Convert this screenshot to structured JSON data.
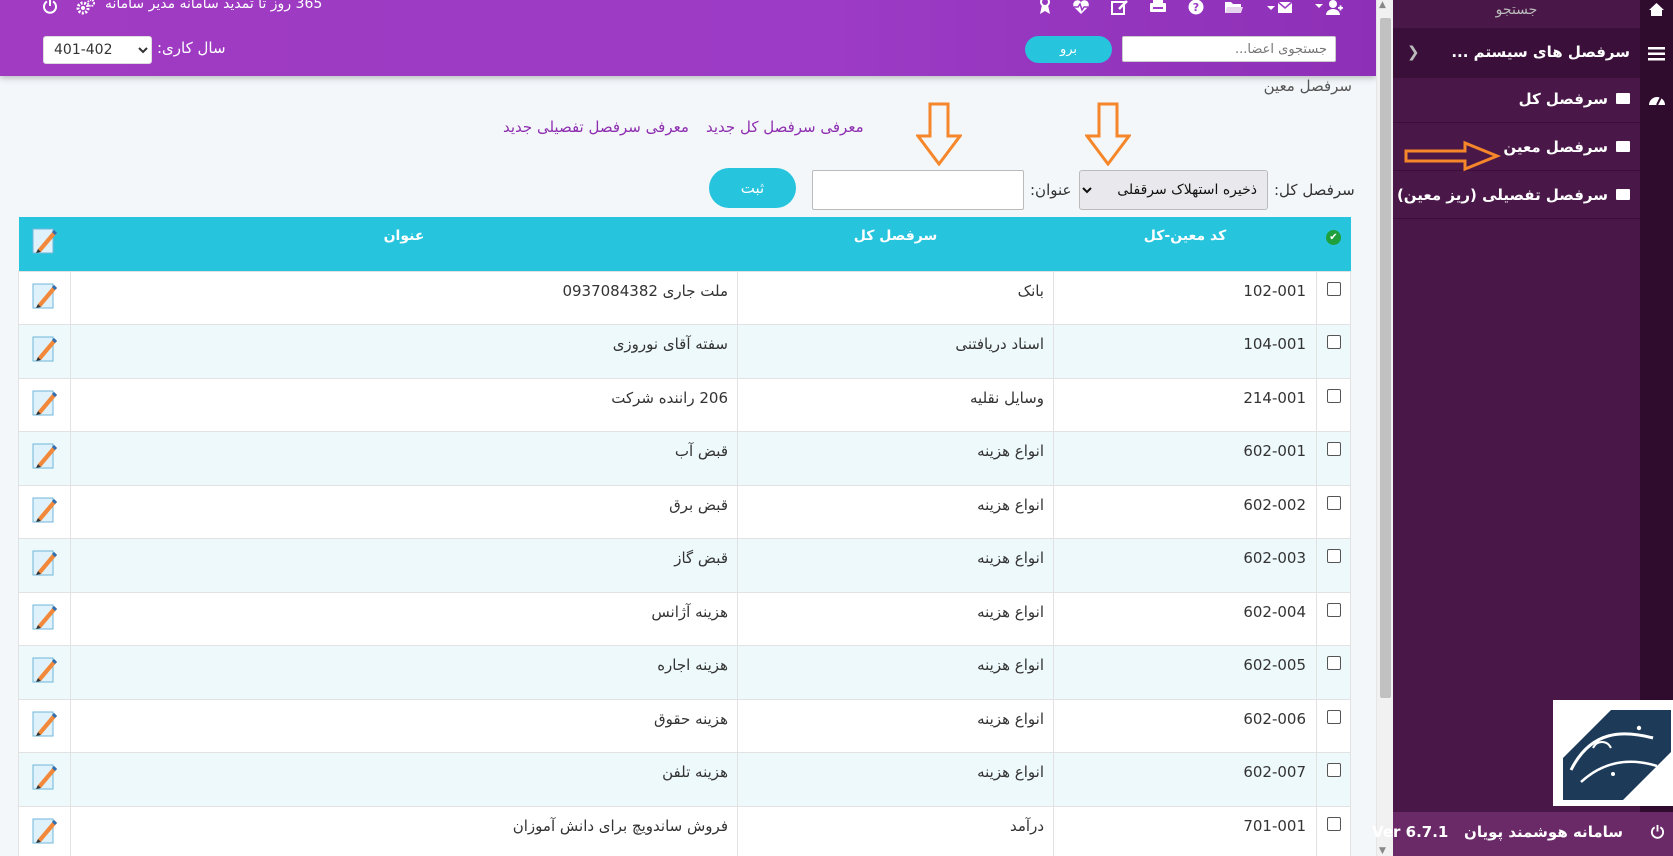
{
  "topbar": {
    "subscription_text": "365 روز تا تمدید سامانه مدیر سامانه",
    "fiscal_year_label": "سال کاری:",
    "fiscal_year_value": "401-402",
    "search_placeholder": "جستجوی اعضا...",
    "search_go_label": "برو",
    "icons": [
      "user-plus-icon",
      "envelope-icon",
      "folder-open-icon",
      "help-icon",
      "printer-icon",
      "edit-note-icon",
      "heartbeat-icon",
      "ribbon-icon"
    ]
  },
  "breadcrumb": "سرفصل معین",
  "links": {
    "new_general": "معرفی سرفصل کل جدید",
    "new_detail": "معرفی سرفصل تفصیلی جدید"
  },
  "form": {
    "general_label": "سرفصل کل:",
    "general_selected": "ذخیره استهلاک سرقفلی",
    "title_label": "عنوان:",
    "title_value": "",
    "save_label": "ثبت"
  },
  "table": {
    "headers": {
      "code": "کد معین-کل",
      "general": "سرفصل کل",
      "title": "عنوان"
    },
    "rows": [
      {
        "code": "102-001",
        "general": "بانک",
        "title": "ملت جاری 0937084382"
      },
      {
        "code": "104-001",
        "general": "اسناد دریافتنی",
        "title": "سفته آقای نوروزی"
      },
      {
        "code": "214-001",
        "general": "وسایل نقلیه",
        "title": "206 راننده شرکت"
      },
      {
        "code": "602-001",
        "general": "انواع هزینه",
        "title": "قبض آب"
      },
      {
        "code": "602-002",
        "general": "انواع هزینه",
        "title": "قبض برق"
      },
      {
        "code": "602-003",
        "general": "انواع هزینه",
        "title": "قبض گاز"
      },
      {
        "code": "602-004",
        "general": "انواع هزینه",
        "title": "هزینه آژانس"
      },
      {
        "code": "602-005",
        "general": "انواع هزینه",
        "title": "هزینه اجاره"
      },
      {
        "code": "602-006",
        "general": "انواع هزینه",
        "title": "هزینه حقوق"
      },
      {
        "code": "602-007",
        "general": "انواع هزینه",
        "title": "هزینه تلفن"
      },
      {
        "code": "701-001",
        "general": "درآمد",
        "title": "فروش ساندویچ برای دانش آموزان"
      }
    ]
  },
  "sidebar": {
    "search_label": "جستجو",
    "parent_label": "سرفصل های سیستم ...",
    "items": [
      {
        "label": "سرفصل کل"
      },
      {
        "label": "سرفصل معین"
      },
      {
        "label": "سرفصل تفصیلی (ریز معین)"
      }
    ],
    "footer_text": "سامانه هوشمند پویان",
    "version": "Ver 6.7.1"
  },
  "colors": {
    "topbar": "#9c3bc5",
    "accent": "#26c4dd",
    "sidebar": "#4a1848",
    "link": "#8e2fb0",
    "annotation_arrow": "#f5862a"
  }
}
